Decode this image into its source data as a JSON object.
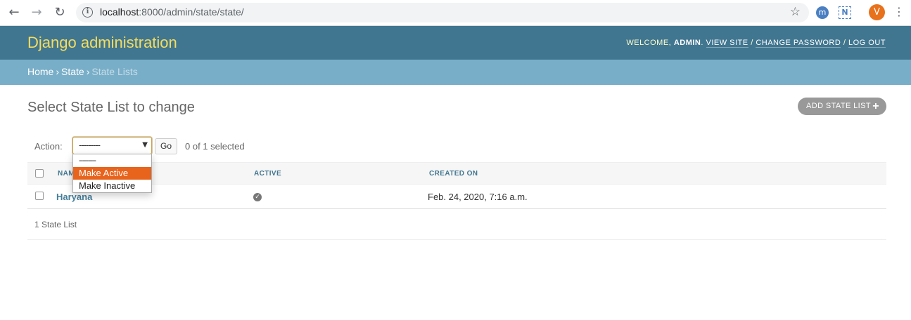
{
  "browser": {
    "url_host": "localhost",
    "url_path": ":8000/admin/state/state/",
    "avatar_letter": "V",
    "ext_m": "m",
    "ext_n": "N"
  },
  "header": {
    "brand": "Django administration",
    "welcome": "WELCOME,",
    "user": "ADMIN",
    "view_site": "VIEW SITE",
    "change_password": "CHANGE PASSWORD",
    "log_out": "LOG OUT"
  },
  "breadcrumbs": {
    "home": "Home",
    "app": "State",
    "current": "State Lists"
  },
  "content": {
    "title": "Select State List to change",
    "add_button": "ADD STATE LIST",
    "action_label": "Action:",
    "action_selected": "---------",
    "go_label": "Go",
    "selection_count": "0 of 1 selected",
    "action_options": [
      "---------",
      "Make Active",
      "Make Inactive"
    ],
    "columns": [
      "NAME",
      "ACTIVE",
      "CREATED ON"
    ],
    "rows": [
      {
        "name": "Haryana",
        "active": true,
        "created_on": "Feb. 24, 2020, 7:16 a.m."
      }
    ],
    "paginator": "1 State List"
  },
  "colors": {
    "header_bg": "#417690",
    "breadcrumb_bg": "#79aec8",
    "brand": "#f5dd5d",
    "highlight": "#e8631c"
  }
}
